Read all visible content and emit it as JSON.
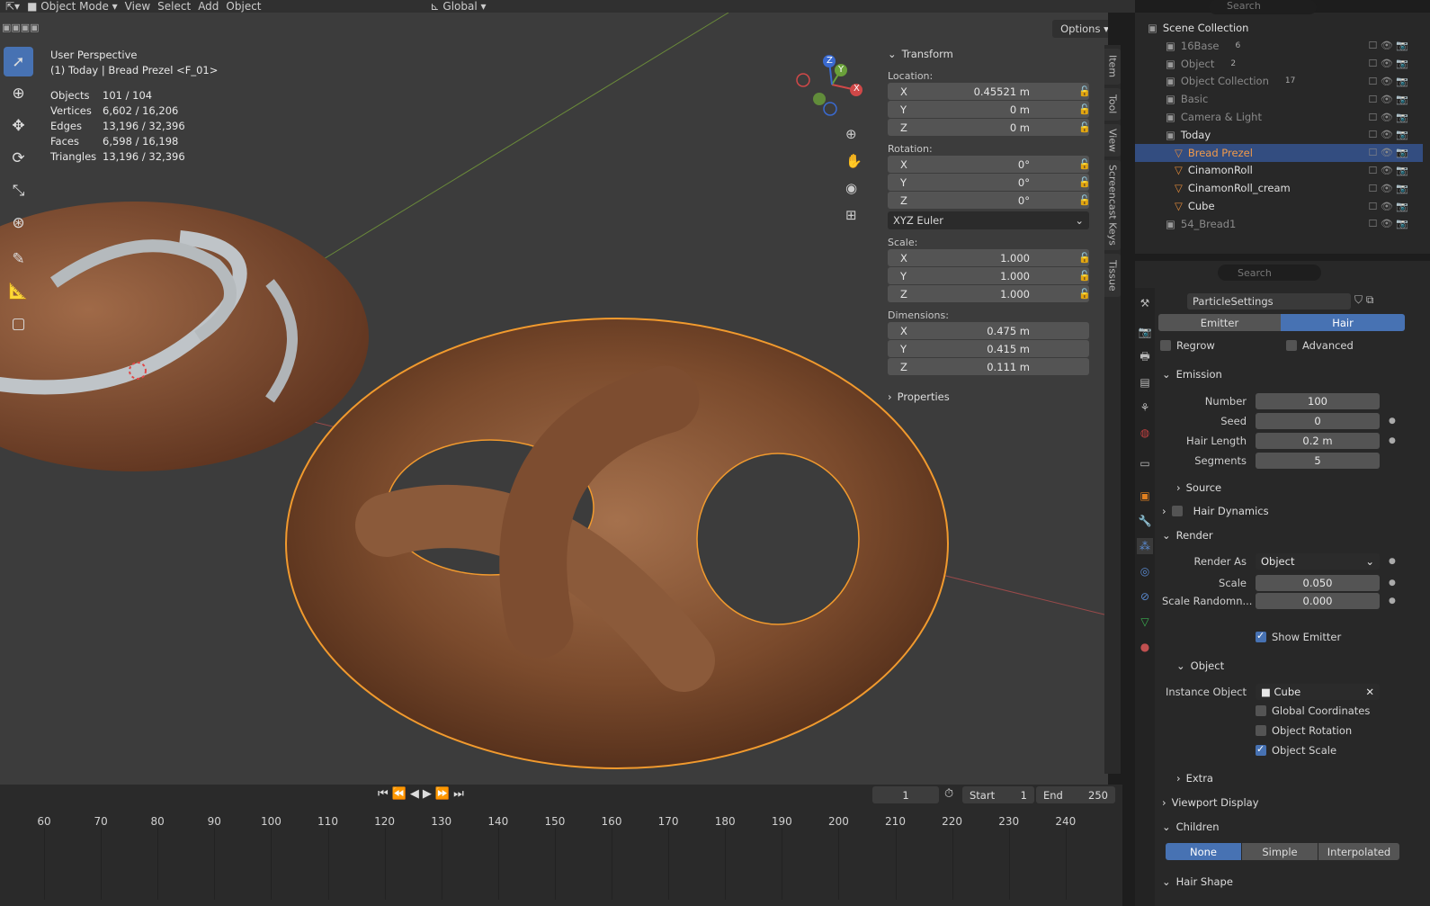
{
  "header": {
    "mode": "Object Mode",
    "menus": [
      "View",
      "Select",
      "Add",
      "Object"
    ],
    "orientation": "Global",
    "options_label": "Options"
  },
  "viewport": {
    "perspective": "User Perspective",
    "context": "(1) Today | Bread Prezel <F_01>",
    "stats": [
      {
        "label": "Objects",
        "value": "101 / 104"
      },
      {
        "label": "Vertices",
        "value": "6,602 / 16,206"
      },
      {
        "label": "Edges",
        "value": "13,196 / 32,396"
      },
      {
        "label": "Faces",
        "value": "6,598 / 16,198"
      },
      {
        "label": "Triangles",
        "value": "13,196 / 32,396"
      }
    ],
    "gizmo_axes": {
      "x": "X",
      "y": "Y",
      "z": "Z"
    }
  },
  "transform": {
    "title": "Transform",
    "location_label": "Location:",
    "location": [
      {
        "axis": "X",
        "value": "0.45521 m"
      },
      {
        "axis": "Y",
        "value": "0 m"
      },
      {
        "axis": "Z",
        "value": "0 m"
      }
    ],
    "rotation_label": "Rotation:",
    "rotation": [
      {
        "axis": "X",
        "value": "0°"
      },
      {
        "axis": "Y",
        "value": "0°"
      },
      {
        "axis": "Z",
        "value": "0°"
      }
    ],
    "rotation_mode": "XYZ Euler",
    "scale_label": "Scale:",
    "scale": [
      {
        "axis": "X",
        "value": "1.000"
      },
      {
        "axis": "Y",
        "value": "1.000"
      },
      {
        "axis": "Z",
        "value": "1.000"
      }
    ],
    "dimensions_label": "Dimensions:",
    "dimensions": [
      {
        "axis": "X",
        "value": "0.475 m"
      },
      {
        "axis": "Y",
        "value": "0.415 m"
      },
      {
        "axis": "Z",
        "value": "0.111 m"
      }
    ],
    "properties_label": "Properties"
  },
  "side_tabs": [
    "Item",
    "Tool",
    "View",
    "Screencast Keys",
    "Tissue"
  ],
  "timeline": {
    "current_frame": "1",
    "start_label": "Start",
    "start": "1",
    "end_label": "End",
    "end": "250",
    "ticks": [
      "60",
      "70",
      "80",
      "90",
      "100",
      "110",
      "120",
      "130",
      "140",
      "150",
      "160",
      "170",
      "180",
      "190",
      "200",
      "210",
      "220",
      "230",
      "240"
    ]
  },
  "outliner": {
    "search_placeholder": "Search",
    "rows": [
      {
        "label": "Scene Collection",
        "bright": true
      },
      {
        "label": "16Base",
        "badge": "6"
      },
      {
        "label": "Object",
        "badge": "2"
      },
      {
        "label": "Object Collection",
        "badge": "17"
      },
      {
        "label": "Basic"
      },
      {
        "label": "Camera & Light"
      },
      {
        "label": "Today",
        "bright": true
      },
      {
        "label": "Bread Prezel",
        "selected": true
      },
      {
        "label": "CinamonRoll",
        "bright": true
      },
      {
        "label": "CinamonRoll_cream",
        "bright": true
      },
      {
        "label": "Cube",
        "bright": true
      },
      {
        "label": "54_Bread1"
      }
    ]
  },
  "properties": {
    "search_placeholder": "Search",
    "settings_name": "ParticleSettings",
    "type_tabs": [
      "Emitter",
      "Hair"
    ],
    "regrow": "Regrow",
    "advanced": "Advanced",
    "emission_title": "Emission",
    "emission": [
      {
        "label": "Number",
        "value": "100"
      },
      {
        "label": "Seed",
        "value": "0"
      },
      {
        "label": "Hair Length",
        "value": "0.2 m"
      },
      {
        "label": "Segments",
        "value": "5"
      }
    ],
    "source": "Source",
    "hair_dynamics": "Hair Dynamics",
    "render_title": "Render",
    "render_as_label": "Render As",
    "render_as": "Object",
    "scale_label": "Scale",
    "scale": "0.050",
    "scale_random_label": "Scale Randomn...",
    "scale_random": "0.000",
    "show_emitter": "Show Emitter",
    "object_title": "Object",
    "instance_object_label": "Instance Object",
    "instance_object": "Cube",
    "global_coordinates": "Global Coordinates",
    "object_rotation": "Object Rotation",
    "object_scale": "Object Scale",
    "extra": "Extra",
    "viewport_display": "Viewport Display",
    "children_title": "Children",
    "children_tabs": [
      "None",
      "Simple",
      "Interpolated"
    ],
    "hair_shape": "Hair Shape"
  },
  "colors": {
    "accent": "#4772b3",
    "selection_outline": "#f19a2e",
    "viewport_bg": "#3c3c3c",
    "panel_bg": "#282828"
  }
}
